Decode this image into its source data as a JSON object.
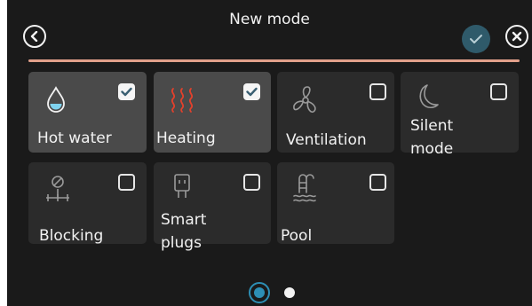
{
  "header": {
    "title": "New mode",
    "back_icon": "chevron-left-circle-icon",
    "confirm_icon": "checkmark-icon",
    "close_icon": "close-circle-icon"
  },
  "colors": {
    "background": "#1a1a1a",
    "tile": "#2b2b2b",
    "tile_selected": "#4a4a4a",
    "accent_line": "#e2a08b",
    "confirm_button": "#2f5a6a",
    "page_indicator": "#2d8fb5",
    "heating_icon": "#e2412c",
    "water_icon": "#7fd3ef"
  },
  "modes": [
    {
      "label": "Hot water",
      "checked": true,
      "icon": "water-drop-icon"
    },
    {
      "label": "Heating",
      "checked": true,
      "icon": "heat-waves-icon"
    },
    {
      "label": "Ventilation",
      "checked": false,
      "icon": "fan-icon"
    },
    {
      "label": "Silent\nmode",
      "checked": false,
      "icon": "moon-icon"
    },
    {
      "label": "Blocking",
      "checked": false,
      "icon": "blocking-icon"
    },
    {
      "label": "Smart\nplugs",
      "checked": false,
      "icon": "smart-plug-icon"
    },
    {
      "label": "Pool",
      "checked": false,
      "icon": "pool-ladder-icon"
    }
  ],
  "pagination": {
    "pages": 2,
    "current": 1
  }
}
